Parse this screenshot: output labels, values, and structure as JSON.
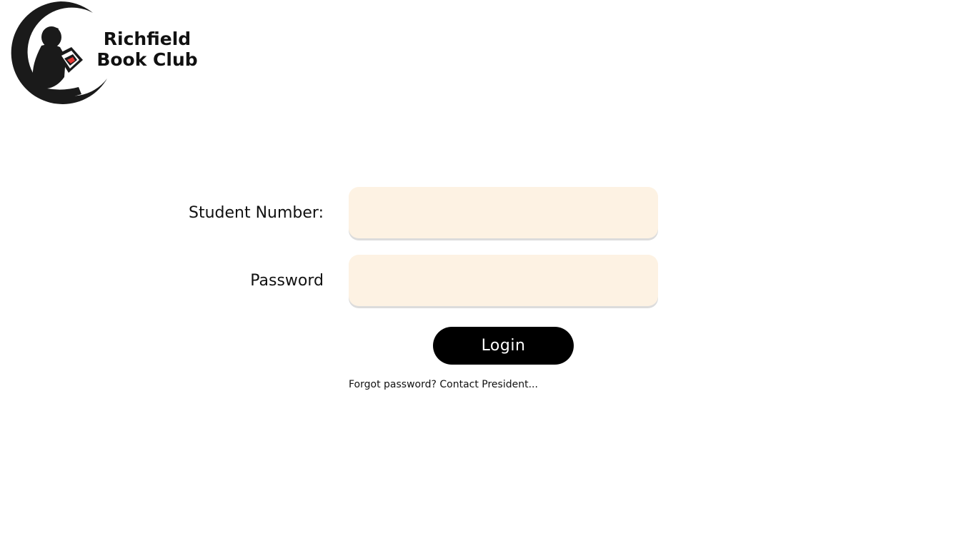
{
  "logo": {
    "line1": "Richfield",
    "line2": "Book Club",
    "icon": "reading-boy-on-moon-icon"
  },
  "login_form": {
    "student_number_label": "Student Number:",
    "student_number_value": "",
    "student_number_placeholder": "",
    "password_label": "Password",
    "password_value": "",
    "password_placeholder": "",
    "login_button_label": "Login",
    "forgot_password_text": "Forgot password? Contact President..."
  },
  "colors": {
    "background": "#ffffff",
    "input_fill": "#fdf2e3",
    "button_fill": "#000000",
    "button_text": "#ffffff",
    "logo_book_accent": "#e53935"
  }
}
